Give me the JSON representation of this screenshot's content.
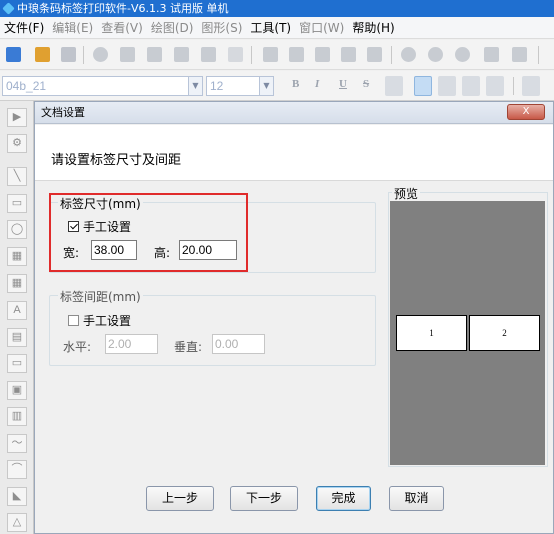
{
  "window": {
    "title": "中琅条码标签打印软件-V6.1.3 试用版 单机"
  },
  "menu": [
    {
      "label": "文件(F)",
      "enabled": true
    },
    {
      "label": "编辑(E)",
      "enabled": false
    },
    {
      "label": "查看(V)",
      "enabled": false
    },
    {
      "label": "绘图(D)",
      "enabled": false
    },
    {
      "label": "图形(S)",
      "enabled": false
    },
    {
      "label": "工具(T)",
      "enabled": true
    },
    {
      "label": "窗口(W)",
      "enabled": false
    },
    {
      "label": "帮助(H)",
      "enabled": true
    }
  ],
  "format_toolbar": {
    "font_name": "04b_21",
    "font_size": "12",
    "bold": "B",
    "italic": "I",
    "underline": "U",
    "strike": "S"
  },
  "left_tools": [
    "▶",
    "⚙",
    "╲",
    "▭",
    "◯",
    "▦",
    "▦",
    "A",
    "▤",
    "▭",
    "▣",
    "▥",
    "〜",
    "⌒",
    "◣",
    "△"
  ],
  "dialog": {
    "title": "文档设置",
    "close_label": "X",
    "header_text": "请设置标签尺寸及间距",
    "size_group": {
      "legend": "标签尺寸(mm)",
      "manual_label": "手工设置",
      "manual_checked": true,
      "width_label": "宽:",
      "width_value": "38.00",
      "height_label": "高:",
      "height_value": "20.00"
    },
    "spacing_group": {
      "legend": "标签间距(mm)",
      "manual_label": "手工设置",
      "manual_checked": false,
      "horizontal_label": "水平:",
      "horizontal_value": "2.00",
      "vertical_label": "垂直:",
      "vertical_value": "0.00"
    },
    "preview": {
      "legend": "预览",
      "labels": [
        "1",
        "2"
      ]
    },
    "buttons": {
      "prev": "上一步",
      "next": "下一步",
      "finish": "完成",
      "cancel": "取消"
    }
  },
  "colors": {
    "titlebar": "#1f6fd0",
    "highlight_box": "#e02b2b",
    "preview_bg": "#808080"
  }
}
